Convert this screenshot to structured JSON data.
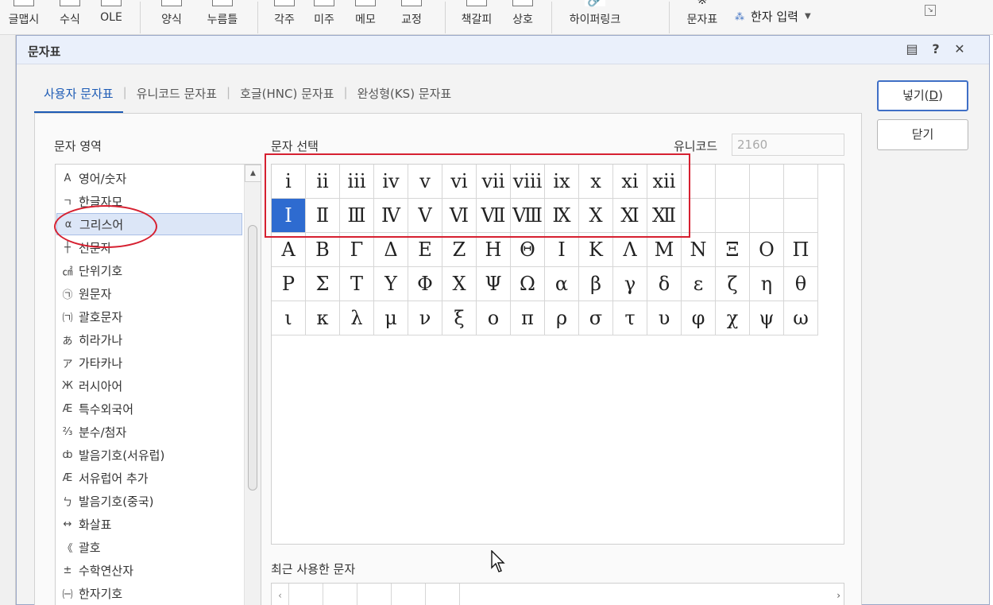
{
  "ribbon": {
    "items": [
      {
        "label": "글맵시"
      },
      {
        "label": "수식"
      },
      {
        "label": "OLE"
      },
      {
        "label": "양식"
      },
      {
        "label": "누름틀"
      },
      {
        "label": "각주"
      },
      {
        "label": "미주"
      },
      {
        "label": "메모"
      },
      {
        "label": "교정"
      },
      {
        "label": "책갈피"
      },
      {
        "label": "상호"
      },
      {
        "label": "하이퍼링크"
      },
      {
        "label": "문자표"
      }
    ],
    "hanja_label": "한자 입력"
  },
  "dialog": {
    "title": "문자표",
    "tabs": [
      {
        "label": "사용자 문자표"
      },
      {
        "label": "유니코드 문자표"
      },
      {
        "label": "호글(HNC) 문자표"
      },
      {
        "label": "완성형(KS) 문자표"
      }
    ],
    "category_title": "문자 영역",
    "categories": [
      {
        "icon": "A",
        "label": "영어/숫자"
      },
      {
        "icon": "ㄱ",
        "label": "한글자모"
      },
      {
        "icon": "α",
        "label": "그리스어"
      },
      {
        "icon": "┼",
        "label": "선문자"
      },
      {
        "icon": "㎠",
        "label": "단위기호"
      },
      {
        "icon": "㉠",
        "label": "원문자"
      },
      {
        "icon": "㈀",
        "label": "괄호문자"
      },
      {
        "icon": "あ",
        "label": "히라가나"
      },
      {
        "icon": "ア",
        "label": "가타카나"
      },
      {
        "icon": "Ж",
        "label": "러시아어"
      },
      {
        "icon": "Æ",
        "label": "특수외국어"
      },
      {
        "icon": "⅔",
        "label": "분수/첨자"
      },
      {
        "icon": "ȸ",
        "label": "발음기호(서유럽)"
      },
      {
        "icon": "Æ",
        "label": "서유럽어 추가"
      },
      {
        "icon": "ㄅ",
        "label": "발음기호(중국)"
      },
      {
        "icon": "↔",
        "label": "화살표"
      },
      {
        "icon": "《",
        "label": "괄호"
      },
      {
        "icon": "±",
        "label": "수학연산자"
      },
      {
        "icon": "㈠",
        "label": "한자기호"
      }
    ],
    "selected_category_index": 2,
    "char_select_title": "문자 선택",
    "unicode_label": "유니코드",
    "unicode_value": "2160",
    "char_rows": [
      [
        "ⅰ",
        "ⅱ",
        "ⅲ",
        "ⅳ",
        "ⅴ",
        "ⅵ",
        "ⅶ",
        "ⅷ",
        "ⅸ",
        "ⅹ",
        "ⅺ",
        "ⅻ",
        "",
        "",
        "",
        ""
      ],
      [
        "Ⅰ",
        "Ⅱ",
        "Ⅲ",
        "Ⅳ",
        "Ⅴ",
        "Ⅵ",
        "Ⅶ",
        "Ⅷ",
        "Ⅸ",
        "Ⅹ",
        "Ⅺ",
        "Ⅻ",
        "",
        "",
        "",
        ""
      ],
      [
        "Α",
        "Β",
        "Γ",
        "Δ",
        "Ε",
        "Ζ",
        "Η",
        "Θ",
        "Ι",
        "Κ",
        "Λ",
        "Μ",
        "Ν",
        "Ξ",
        "Ο",
        "Π"
      ],
      [
        "Ρ",
        "Σ",
        "Τ",
        "Υ",
        "Φ",
        "Χ",
        "Ψ",
        "Ω",
        "α",
        "β",
        "γ",
        "δ",
        "ε",
        "ζ",
        "η",
        "θ"
      ],
      [
        "ι",
        "κ",
        "λ",
        "μ",
        "ν",
        "ξ",
        "ο",
        "π",
        "ρ",
        "σ",
        "τ",
        "υ",
        "φ",
        "χ",
        "ψ",
        "ω"
      ]
    ],
    "selected_char": {
      "row": 1,
      "col": 0
    },
    "recent_title": "최근 사용한 문자",
    "buttons": {
      "insert": "넣기(",
      "insert_key": "D",
      "insert_end": ")",
      "close": "닫기"
    }
  },
  "colors": {
    "accent": "#1d5bb5",
    "selection": "#2e6bd0",
    "annotation": "#d62030"
  }
}
